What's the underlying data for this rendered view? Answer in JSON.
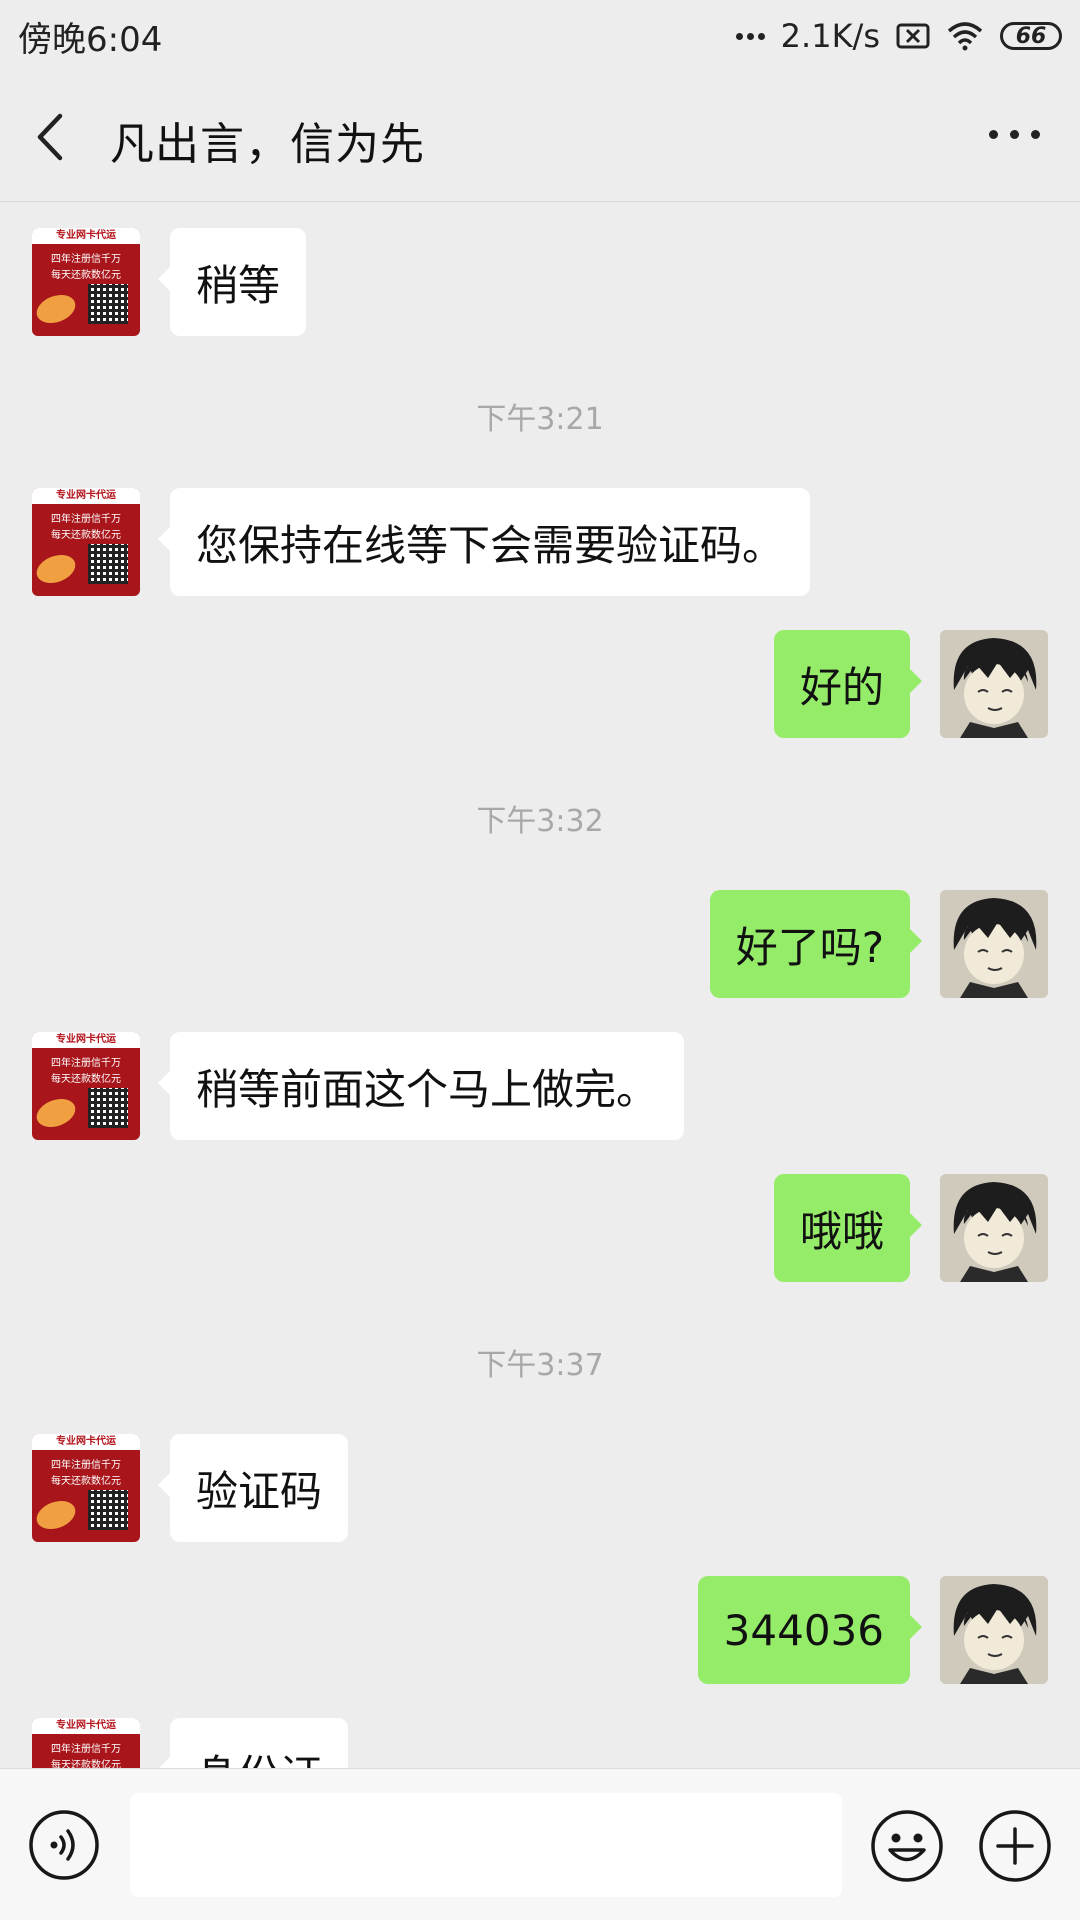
{
  "status_bar": {
    "time": "傍晚6:04",
    "network_speed": "2.1K/s",
    "battery": "66"
  },
  "header": {
    "title": "凡出言，信为先"
  },
  "avatar_left_lines": [
    "专业网卡代运",
    "四年注册信千万",
    "每天还款数亿元"
  ],
  "messages": [
    {
      "side": "left",
      "text": "稍等"
    },
    {
      "type": "time",
      "text": "下午3:21"
    },
    {
      "side": "left",
      "text": "您保持在线等下会需要验证码。"
    },
    {
      "side": "right",
      "text": "好的"
    },
    {
      "type": "time",
      "text": "下午3:32"
    },
    {
      "side": "right",
      "text": "好了吗?"
    },
    {
      "side": "left",
      "text": "稍等前面这个马上做完。"
    },
    {
      "side": "right",
      "text": "哦哦"
    },
    {
      "type": "time",
      "text": "下午3:37"
    },
    {
      "side": "left",
      "text": "验证码"
    },
    {
      "side": "right",
      "text": "344036"
    },
    {
      "side": "left",
      "text": "身份证"
    }
  ],
  "colors": {
    "background": "#ededed",
    "bubble_self": "#95ec69",
    "bubble_other": "#ffffff",
    "timestamp": "#a8a8a8"
  }
}
